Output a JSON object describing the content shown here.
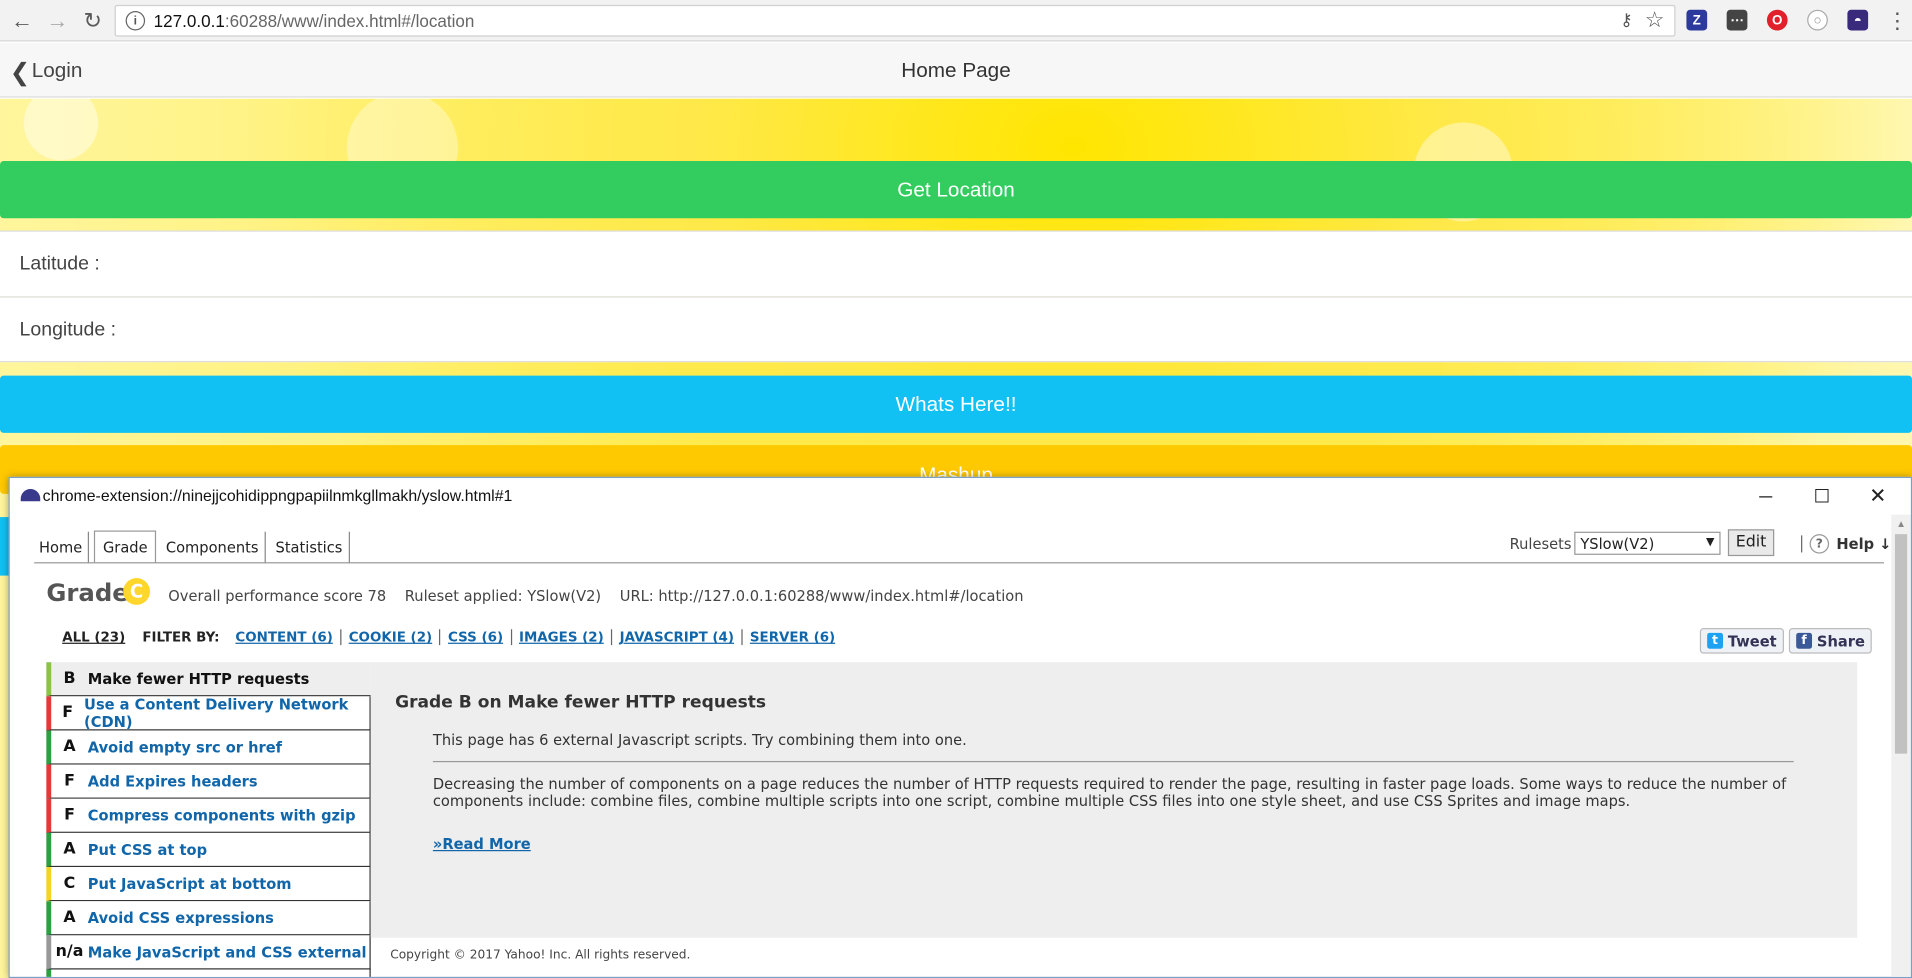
{
  "browser": {
    "url_host": "127.0.0.1",
    "url_rest": ":60288/www/index.html#/location",
    "extensions": [
      "Z-extension-icon",
      "dots-extension-icon",
      "opera-extension-icon",
      "circle-extension-icon",
      "yslow-extension-icon"
    ]
  },
  "app": {
    "back_label": "Login",
    "title": "Home Page",
    "get_location": "Get Location",
    "latitude_label": "Latitude :",
    "longitude_label": "Longitude :",
    "whats_here": "Whats Here!!",
    "mashup": "Mashup"
  },
  "popup": {
    "url": "chrome-extension://ninejjcohidippngpapiilnmkgllmakh/yslow.html#1",
    "tabs": [
      "Home",
      "Grade",
      "Components",
      "Statistics"
    ],
    "active_tab": "Grade",
    "rulesets_label": "Rulesets",
    "rulesets_value": "YSlow(V2)",
    "edit_label": "Edit",
    "help_label": "Help ↓",
    "grade_title": "Grade",
    "grade_letter": "C",
    "score_line": "Overall performance score 78    Ruleset applied: YSlow(V2)    URL: http://127.0.0.1:60288/www/index.html#/location",
    "filter_all": "ALL (23)",
    "filter_by": "FILTER BY:",
    "filters": [
      "CONTENT (6)",
      "COOKIE (2)",
      "CSS (6)",
      "IMAGES (2)",
      "JAVASCRIPT (4)",
      "SERVER (6)"
    ],
    "tweet_label": "Tweet",
    "share_label": "Share",
    "rules": [
      {
        "grade": "B",
        "name": "Make fewer HTTP requests",
        "color": "#8bc34a"
      },
      {
        "grade": "F",
        "name": "Use a Content Delivery Network (CDN)",
        "color": "#e53935"
      },
      {
        "grade": "A",
        "name": "Avoid empty src or href",
        "color": "#2e9e3e"
      },
      {
        "grade": "F",
        "name": "Add Expires headers",
        "color": "#e53935"
      },
      {
        "grade": "F",
        "name": "Compress components with gzip",
        "color": "#e53935"
      },
      {
        "grade": "A",
        "name": "Put CSS at top",
        "color": "#2e9e3e"
      },
      {
        "grade": "C",
        "name": "Put JavaScript at bottom",
        "color": "#f5d31f"
      },
      {
        "grade": "A",
        "name": "Avoid CSS expressions",
        "color": "#2e9e3e"
      },
      {
        "grade": "n/a",
        "name": "Make JavaScript and CSS external",
        "color": "#999999"
      },
      {
        "grade": "",
        "name": "",
        "color": "#2e9e3e"
      }
    ],
    "detail_title": "Grade B on Make fewer HTTP requests",
    "detail_msg": "This page has 6 external Javascript scripts. Try combining them into one.",
    "detail_body": "Decreasing the number of components on a page reduces the number of HTTP requests required to render the page, resulting in faster page loads. Some ways to reduce the number of components include: combine files, combine multiple scripts into one script, combine multiple CSS files into one style sheet, and use CSS Sprites and image maps.",
    "read_more": "»Read More",
    "copyright": "Copyright © 2017 Yahoo! Inc. All rights reserved."
  }
}
